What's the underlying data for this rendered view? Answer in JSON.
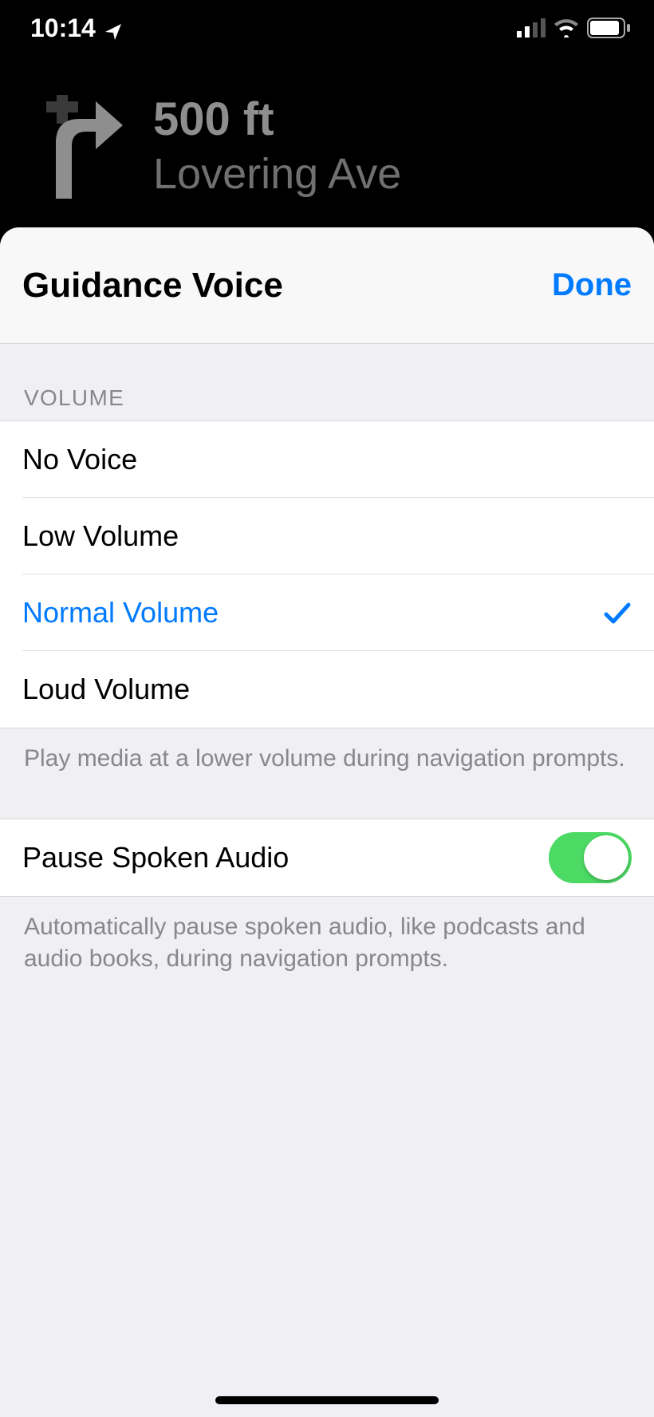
{
  "status": {
    "time": "10:14"
  },
  "navBanner": {
    "distance": "500 ft",
    "street": "Lovering Ave"
  },
  "sheet": {
    "title": "Guidance Voice",
    "doneLabel": "Done",
    "volume": {
      "header": "VOLUME",
      "options": [
        {
          "label": "No Voice",
          "selected": false
        },
        {
          "label": "Low Volume",
          "selected": false
        },
        {
          "label": "Normal Volume",
          "selected": true
        },
        {
          "label": "Loud Volume",
          "selected": false
        }
      ],
      "footer": "Play media at a lower volume during navigation prompts."
    },
    "pause": {
      "label": "Pause Spoken Audio",
      "enabled": true,
      "footer": "Automatically pause spoken audio, like podcasts and audio books, during navigation prompts."
    }
  }
}
